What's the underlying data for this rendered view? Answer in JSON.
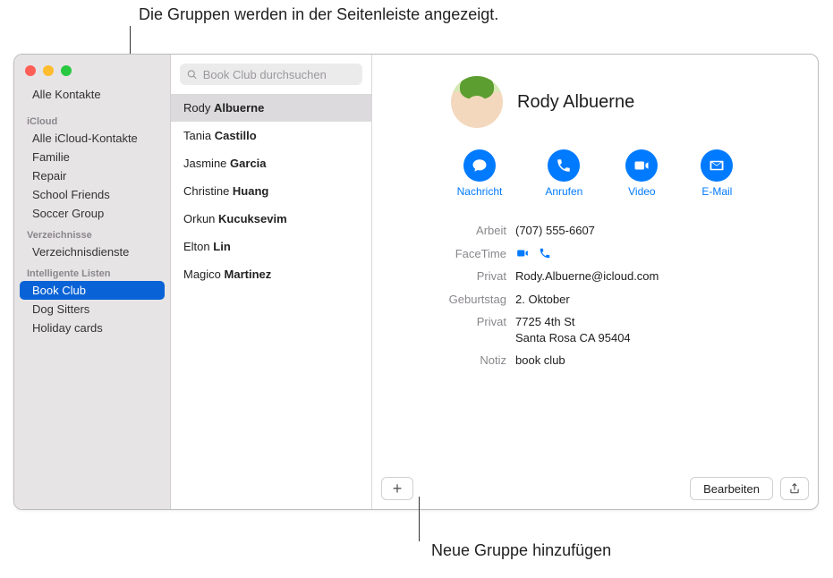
{
  "callouts": {
    "top": "Die Gruppen werden in der Seitenleiste angezeigt.",
    "bottom": "Neue Gruppe hinzufügen"
  },
  "sidebar": {
    "all_contacts": "Alle Kontakte",
    "section_icloud": "iCloud",
    "icloud_items": [
      "Alle iCloud-Kontakte",
      "Familie",
      "Repair",
      "School Friends",
      "Soccer Group"
    ],
    "section_directories": "Verzeichnisse",
    "directories_items": [
      "Verzeichnisdienste"
    ],
    "section_smart": "Intelligente Listen",
    "smart_items": [
      "Book Club",
      "Dog Sitters",
      "Holiday cards"
    ],
    "selected_smart": "Book Club"
  },
  "search": {
    "placeholder": "Book Club durchsuchen"
  },
  "contacts": [
    {
      "first": "Rody",
      "last": "Albuerne"
    },
    {
      "first": "Tania",
      "last": "Castillo"
    },
    {
      "first": "Jasmine",
      "last": "Garcia"
    },
    {
      "first": "Christine",
      "last": "Huang"
    },
    {
      "first": "Orkun",
      "last": "Kucuksevim"
    },
    {
      "first": "Elton",
      "last": "Lin"
    },
    {
      "first": "Magico",
      "last": "Martinez"
    }
  ],
  "selected_contact_index": 0,
  "detail": {
    "name": "Rody Albuerne",
    "actions": {
      "message": "Nachricht",
      "call": "Anrufen",
      "video": "Video",
      "email": "E-Mail"
    },
    "fields": {
      "work_label": "Arbeit",
      "work_value": "(707) 555-6607",
      "facetime_label": "FaceTime",
      "private_email_label": "Privat",
      "private_email_value": "Rody.Albuerne@icloud.com",
      "birthday_label": "Geburtstag",
      "birthday_value": "2. Oktober",
      "private_addr_label": "Privat",
      "private_addr_line1": "7725 4th St",
      "private_addr_line2": "Santa Rosa CA 95404",
      "note_label": "Notiz",
      "note_value": "book club"
    },
    "edit_label": "Bearbeiten"
  },
  "colors": {
    "accent": "#007aff",
    "sidebar_bg": "#e7e4e6",
    "selection": "#0a63d6"
  }
}
